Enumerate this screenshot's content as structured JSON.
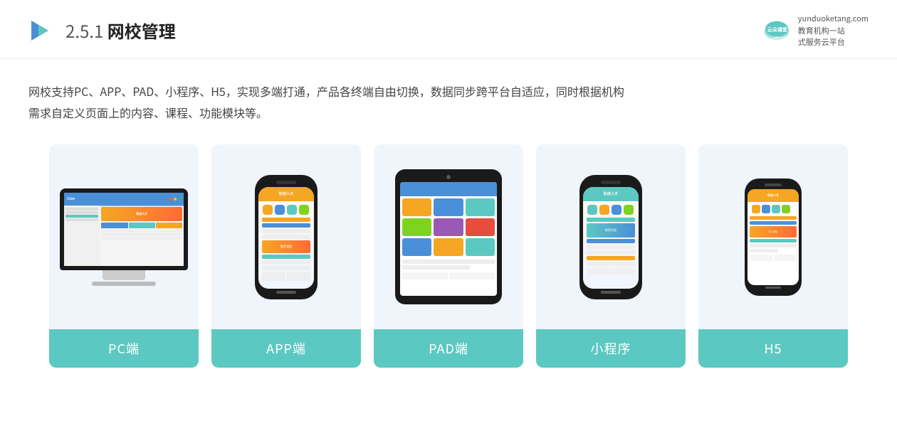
{
  "header": {
    "section_number": "2.5.1",
    "title": "网校管理",
    "brand_name": "云朵课堂",
    "brand_site": "yunduoketang.com",
    "brand_tagline": "教育机构一站\n式服务云平台"
  },
  "description": {
    "line1": "网校支持PC、APP、PAD、小程序、H5，实现多端打通，产品各终端自由切换，数据同步跨平台自适应，同时根据机构",
    "line2": "需求自定义页面上的内容、课程、功能模块等。"
  },
  "cards": [
    {
      "id": "pc",
      "label": "PC端"
    },
    {
      "id": "app",
      "label": "APP端"
    },
    {
      "id": "pad",
      "label": "PAD端"
    },
    {
      "id": "miniprogram",
      "label": "小程序"
    },
    {
      "id": "h5",
      "label": "H5"
    }
  ]
}
